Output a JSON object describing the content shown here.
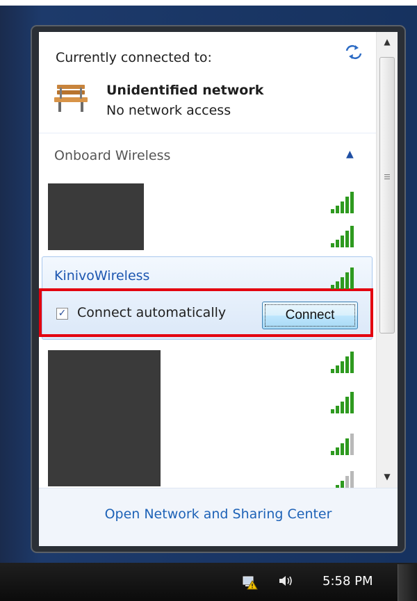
{
  "header": {
    "currently_connected_label": "Currently connected to:",
    "refresh_icon": "refresh-icon"
  },
  "current_network": {
    "name": "Unidentified network",
    "status": "No network access",
    "icon": "bench-icon"
  },
  "section": {
    "label": "Onboard Wireless",
    "collapse_icon": "chevron-up-icon"
  },
  "networks": [
    {
      "name": "",
      "signal_bars": 5,
      "redacted": true
    },
    {
      "name": "",
      "signal_bars": 5,
      "redacted": true
    },
    {
      "name": "KinivoWireless",
      "signal_bars": 5,
      "selected": true
    },
    {
      "name": "",
      "signal_bars": 5,
      "redacted": true
    },
    {
      "name": "",
      "signal_bars": 5,
      "redacted": true
    },
    {
      "name": "",
      "signal_bars": 4,
      "redacted": true
    },
    {
      "name": "",
      "signal_bars": 3,
      "redacted": true
    }
  ],
  "selected_network": {
    "name": "KinivoWireless",
    "connect_automatically_label": "Connect automatically",
    "connect_automatically_checked": true,
    "connect_button_label": "Connect"
  },
  "footer": {
    "link_label": "Open Network and Sharing Center"
  },
  "taskbar": {
    "clock": "5:58 PM",
    "volume_icon": "speaker-icon",
    "network_icon": "network-warning-icon"
  },
  "colors": {
    "link_blue": "#1d62b7",
    "signal_green": "#2e9a1f",
    "highlight_red": "#e3000f"
  }
}
